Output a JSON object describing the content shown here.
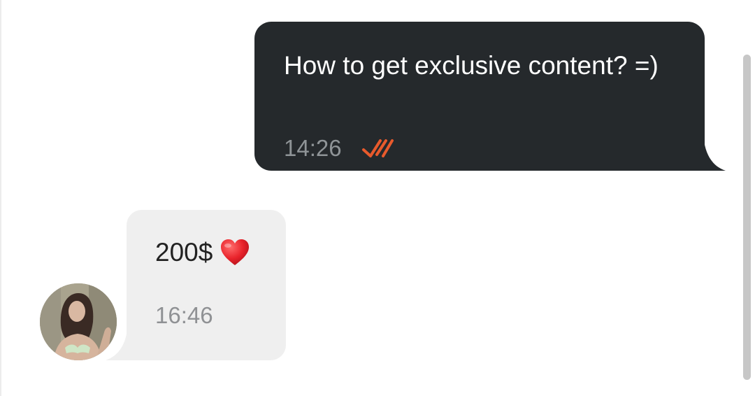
{
  "conversation": {
    "messages": [
      {
        "direction": "outgoing",
        "text": "How to get exclusive content? =)",
        "time": "14:26",
        "status_icon": "double-check-read-icon",
        "status_color": "#e85a2c"
      },
      {
        "direction": "incoming",
        "text": "200$",
        "emoji_icon": "red-heart-icon",
        "time": "16:46",
        "sender_avatar": "contact-avatar"
      }
    ]
  },
  "colors": {
    "outgoing_bubble": "#25292c",
    "incoming_bubble": "#efefef",
    "accent": "#e85a2c"
  }
}
